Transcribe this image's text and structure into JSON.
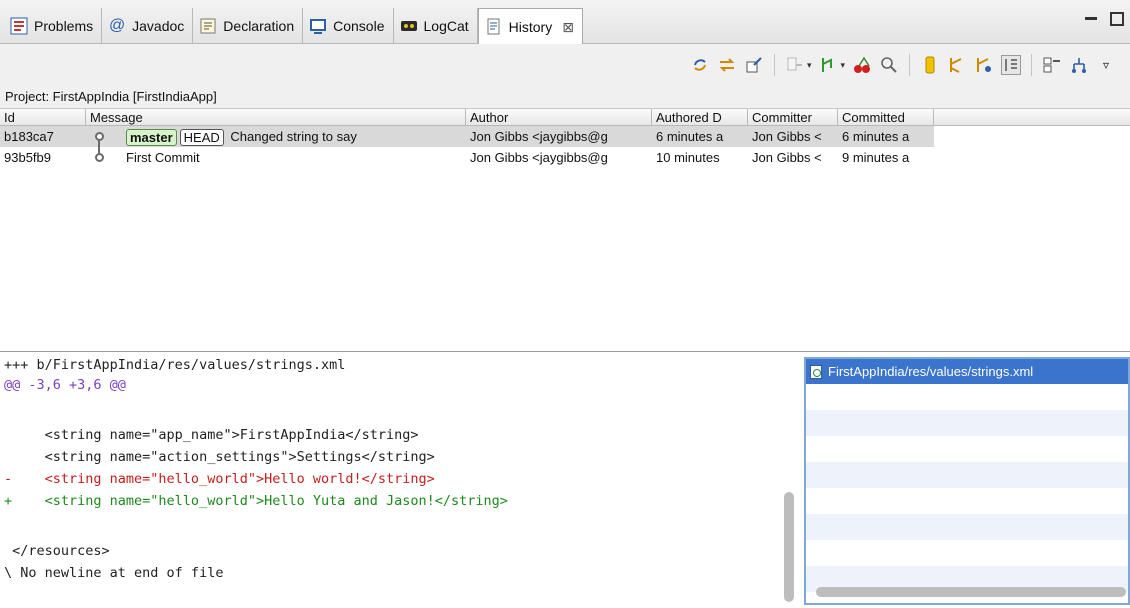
{
  "tabs": [
    {
      "label": "Problems",
      "icon": "problems-icon"
    },
    {
      "label": "Javadoc",
      "icon": "javadoc-icon"
    },
    {
      "label": "Declaration",
      "icon": "declaration-icon"
    },
    {
      "label": "Console",
      "icon": "console-icon"
    },
    {
      "label": "LogCat",
      "icon": "logcat-icon"
    },
    {
      "label": "History",
      "icon": "history-icon",
      "active": true,
      "close": "⊠"
    }
  ],
  "project_label": "Project: FirstAppIndia [FirstIndiaApp]",
  "table": {
    "headers": [
      "Id",
      "Message",
      "Author",
      "Authored D",
      "Committer",
      "Committed"
    ],
    "rows": [
      {
        "id": "b183ca7",
        "branch": "master",
        "head": "HEAD",
        "message": "Changed string to say",
        "author": "Jon Gibbs <jaygibbs@g",
        "authored": "6 minutes a",
        "committer": "Jon Gibbs <",
        "committed": "6 minutes a"
      },
      {
        "id": "93b5fb9",
        "message": "First Commit",
        "author": "Jon Gibbs <jaygibbs@g",
        "authored": "10 minutes",
        "committer": "Jon Gibbs <",
        "committed": "9 minutes a"
      }
    ]
  },
  "diff": {
    "file_header": "+++ b/FirstAppIndia/res/values/strings.xml",
    "hunk": "@@ -3,6 +3,6 @@",
    "ctx1": "     <string name=\"app_name\">FirstAppIndia</string>",
    "ctx2": "     <string name=\"action_settings\">Settings</string>",
    "del": "-    <string name=\"hello_world\">Hello world!</string>",
    "add": "+    <string name=\"hello_world\">Hello Yuta and Jason!</string>",
    "ctx3": " </resources>",
    "noeol": "\\ No newline at end of file"
  },
  "files": [
    "FirstAppIndia/res/values/strings.xml"
  ],
  "colors": {
    "selection": "#3b74cc",
    "diff_add": "#1d8a1d",
    "diff_del": "#c41e1e",
    "diff_hunk": "#7a3fbf",
    "branch_badge": "#d7f3c9"
  }
}
